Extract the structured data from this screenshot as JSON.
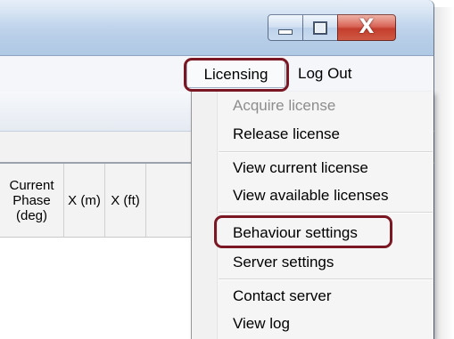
{
  "window": {
    "controls": {
      "minimize_icon": "minimize-icon",
      "maximize_icon": "maximize-icon",
      "close_icon": "close-icon",
      "close_glyph": "X"
    }
  },
  "menubar": {
    "licensing_label": "Licensing",
    "logout_label": "Log Out"
  },
  "grid": {
    "columns": [
      {
        "label": "Current\nPhase\n(deg)"
      },
      {
        "label": "X (m)"
      },
      {
        "label": "X (ft)"
      }
    ]
  },
  "licensing_menu": {
    "items": [
      {
        "label": "Acquire license",
        "enabled": false
      },
      {
        "label": "Release license",
        "enabled": true
      },
      {
        "label": "View current license",
        "enabled": true
      },
      {
        "label": "View available licenses",
        "enabled": true
      },
      {
        "label": "Behaviour settings",
        "enabled": true
      },
      {
        "label": "Server settings",
        "enabled": true
      },
      {
        "label": "Contact server",
        "enabled": true
      },
      {
        "label": "View log",
        "enabled": true
      }
    ]
  },
  "colors": {
    "highlight_ring": "#7a1722",
    "close_button": "#c43d2d",
    "titlebar": "#c7d9ee"
  }
}
